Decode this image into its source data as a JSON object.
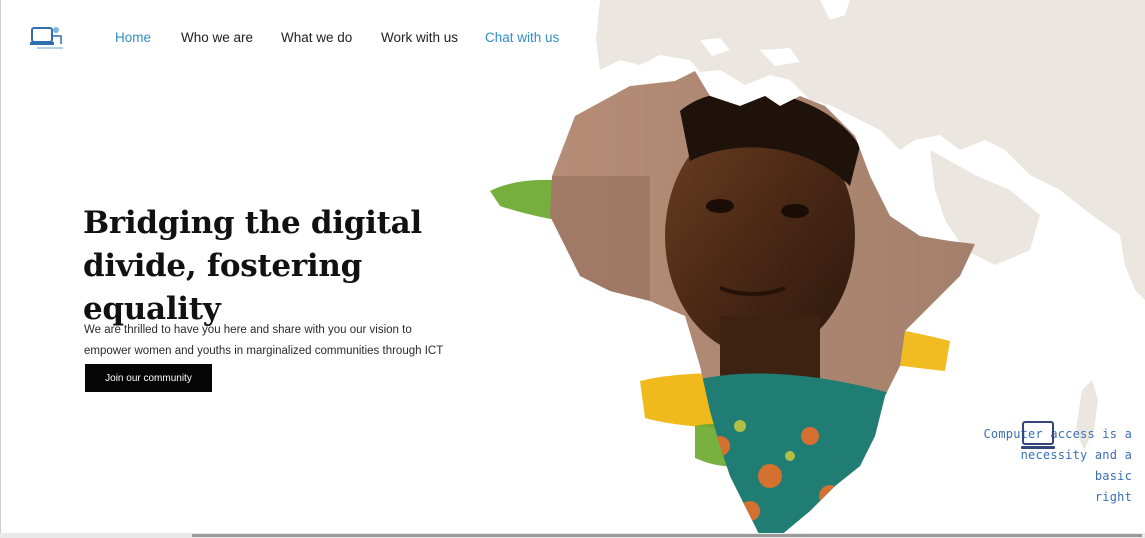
{
  "nav": {
    "items": [
      {
        "label": "Home",
        "active": true
      },
      {
        "label": "Who we are",
        "active": false
      },
      {
        "label": "What we do",
        "active": false
      },
      {
        "label": "Work with us",
        "active": false
      },
      {
        "label": "Chat with us",
        "active": false
      }
    ]
  },
  "hero": {
    "title_line1": "Bridging the digital",
    "title_line2": "divide, fostering equality",
    "description_line1": "We are thrilled to have you here and share with you our vision to",
    "description_line2": "empower women and youths in marginalized communities through ICT",
    "cta_label": "Join our community"
  },
  "caption": {
    "line1": "Computer access is a",
    "line2": "necessity and a basic",
    "line3": "right"
  },
  "icons": {
    "logo": "computer-logo-icon",
    "caption_icon": "laptop-icon"
  },
  "colors": {
    "accent": "#2f8ec9",
    "button_bg": "#060606",
    "map_land": "#ebe6df",
    "caption_text": "#3a6fb8",
    "brush_green": "#6aa82c",
    "brush_yellow": "#efb40a"
  }
}
